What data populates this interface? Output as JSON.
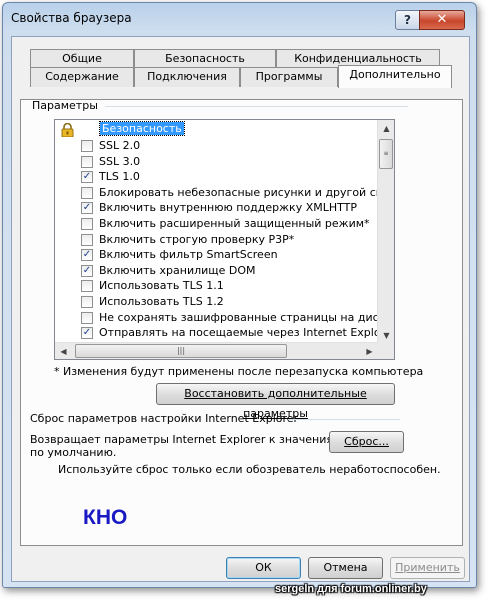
{
  "window": {
    "title": "Свойства браузера",
    "help_label": "?",
    "close_label": "✕"
  },
  "tabs_top": [
    {
      "label": "Общие"
    },
    {
      "label": "Безопасность"
    },
    {
      "label": "Конфиденциальность"
    }
  ],
  "tabs_bottom": [
    {
      "label": "Содержание"
    },
    {
      "label": "Подключения"
    },
    {
      "label": "Программы"
    },
    {
      "label": "Дополнительно",
      "active": true
    }
  ],
  "params": {
    "group_label": "Параметры",
    "category": "Безопасность",
    "items": [
      {
        "label": "SSL 2.0",
        "checked": false
      },
      {
        "label": "SSL 3.0",
        "checked": false
      },
      {
        "label": "TLS 1.0",
        "checked": true
      },
      {
        "label": "Блокировать небезопасные рисунки и другой смешанн",
        "checked": false
      },
      {
        "label": "Включить внутреннюю поддержку XMLHTTP",
        "checked": true
      },
      {
        "label": "Включить расширенный защищенный режим*",
        "checked": false
      },
      {
        "label": "Включить строгую проверку P3P*",
        "checked": false
      },
      {
        "label": "Включить фильтр SmartScreen",
        "checked": true
      },
      {
        "label": "Включить хранилище DOM",
        "checked": true
      },
      {
        "label": "Использовать TLS 1.1",
        "checked": false
      },
      {
        "label": "Использовать TLS 1.2",
        "checked": false
      },
      {
        "label": "Не сохранять зашифрованные страницы на диск",
        "checked": false
      },
      {
        "label": "Отправлять на посещаемые через Internet Explorer ве",
        "checked": true
      }
    ],
    "check_glyph": "✓",
    "restart_note": "* Изменения будут применены после перезапуска компьютера",
    "restore_button": "Восстановить дополнительные параметры"
  },
  "reset": {
    "group_label": "Сброс параметров настройки Internet Explorer",
    "description_line1": "Возвращает параметры Internet Explorer к значениям",
    "description_line2": "по умолчанию.",
    "reset_button": "Сброс...",
    "note": "Используйте сброс только если обозреватель неработоспособен."
  },
  "footer": {
    "ok": "ОК",
    "cancel": "Отмена",
    "apply": "Применить"
  },
  "overlay": {
    "watermark": "КНО",
    "credit": "sergeln для forum.onliner.by"
  }
}
